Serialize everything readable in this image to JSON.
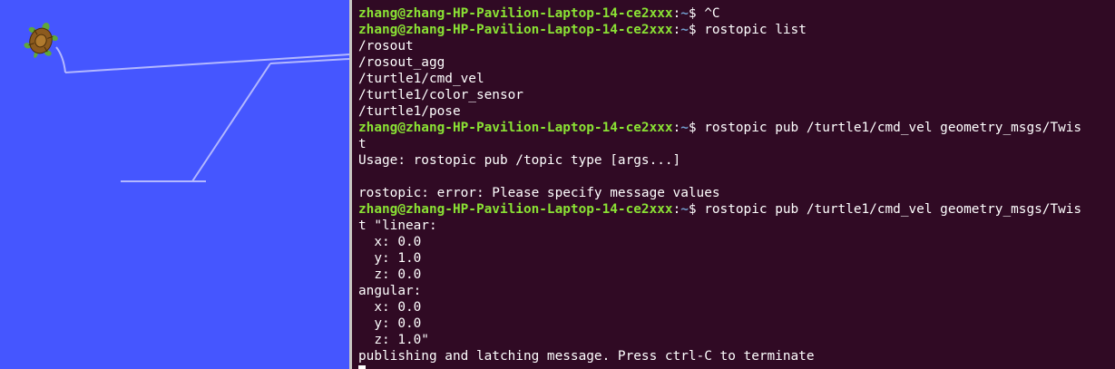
{
  "turtlesim": {
    "background": "#4556ff",
    "pen_color": "#b3b8ff",
    "turtle_icon": "turtle-icon"
  },
  "terminal": {
    "user_host": "zhang@zhang-HP-Pavilion-Laptop-14-ce2xxx",
    "sep": ":",
    "path": "~",
    "prompt_symbol": "$ ",
    "lines": [
      {
        "type": "prompt",
        "cmd": "^C"
      },
      {
        "type": "prompt",
        "cmd": "rostopic list"
      },
      {
        "type": "out",
        "text": "/rosout"
      },
      {
        "type": "out",
        "text": "/rosout_agg"
      },
      {
        "type": "out",
        "text": "/turtle1/cmd_vel"
      },
      {
        "type": "out",
        "text": "/turtle1/color_sensor"
      },
      {
        "type": "out",
        "text": "/turtle1/pose"
      },
      {
        "type": "prompt",
        "cmd": "rostopic pub /turtle1/cmd_vel geometry_msgs/Twis"
      },
      {
        "type": "out",
        "text": "t"
      },
      {
        "type": "out",
        "text": "Usage: rostopic pub /topic type [args...]"
      },
      {
        "type": "out",
        "text": ""
      },
      {
        "type": "out",
        "text": "rostopic: error: Please specify message values"
      },
      {
        "type": "prompt",
        "cmd": "rostopic pub /turtle1/cmd_vel geometry_msgs/Twis"
      },
      {
        "type": "out",
        "text": "t \"linear:"
      },
      {
        "type": "out",
        "text": "  x: 0.0"
      },
      {
        "type": "out",
        "text": "  y: 1.0"
      },
      {
        "type": "out",
        "text": "  z: 0.0"
      },
      {
        "type": "out",
        "text": "angular:"
      },
      {
        "type": "out",
        "text": "  x: 0.0"
      },
      {
        "type": "out",
        "text": "  y: 0.0"
      },
      {
        "type": "out",
        "text": "  z: 1.0\""
      },
      {
        "type": "out",
        "text": "publishing and latching message. Press ctrl-C to terminate"
      },
      {
        "type": "cursor"
      }
    ]
  }
}
